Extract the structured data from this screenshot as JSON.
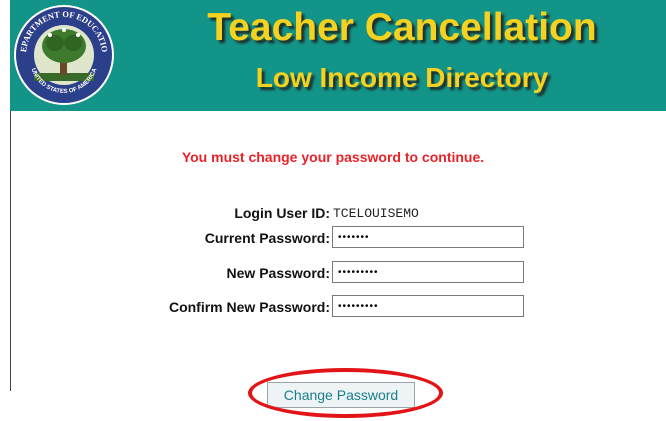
{
  "header": {
    "title_line1": "Teacher Cancellation",
    "title_line2": "Low Income Directory",
    "seal": {
      "icon": "department-of-education-seal-icon",
      "text_top": "DEPARTMENT OF EDUCATION",
      "text_bottom": "UNITED STATES OF AMERICA"
    },
    "colors": {
      "background": "#129488",
      "title": "#f4d21f"
    }
  },
  "form": {
    "alert": "You must change your password to continue.",
    "alert_color": "#e8232a",
    "login_label": "Login User ID:",
    "login_value": "TCELOUISEMO",
    "current_label": "Current Password:",
    "current_mask": "•••••••",
    "new_label": "New Password:",
    "new_mask": "•••••••••",
    "confirm_label": "Confirm New Password:",
    "confirm_mask": "•••••••••",
    "submit_label": "Change Password"
  },
  "annotation": {
    "highlight_color": "#e21418"
  }
}
